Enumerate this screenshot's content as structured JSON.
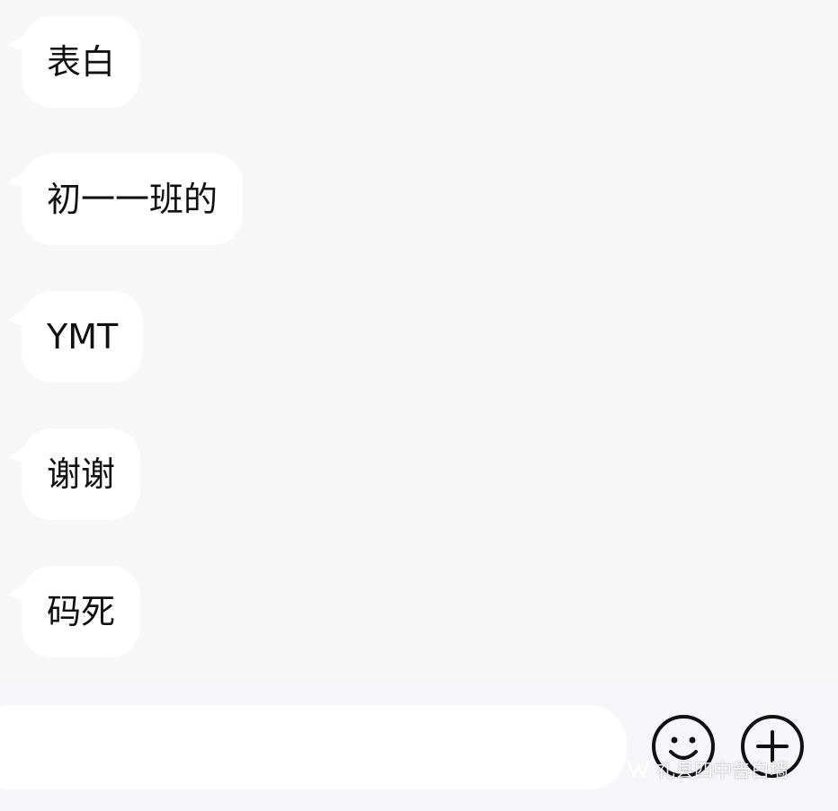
{
  "messages": [
    {
      "text": "表白"
    },
    {
      "text": "初一一班的"
    },
    {
      "text": "YMT"
    },
    {
      "text": "谢谢"
    },
    {
      "text": "码死"
    }
  ],
  "input": {
    "value": "",
    "placeholder": ""
  },
  "toolbar": {
    "emoji_icon": "smiley-face-icon",
    "plus_icon": "plus-circle-icon"
  },
  "watermark": {
    "text": "礼县四中告白墙",
    "icon": "wechat-channel-icon"
  },
  "colors": {
    "background": "#f7f7f8",
    "bubble": "#ffffff",
    "text": "#111111",
    "icon_stroke": "#111111"
  }
}
